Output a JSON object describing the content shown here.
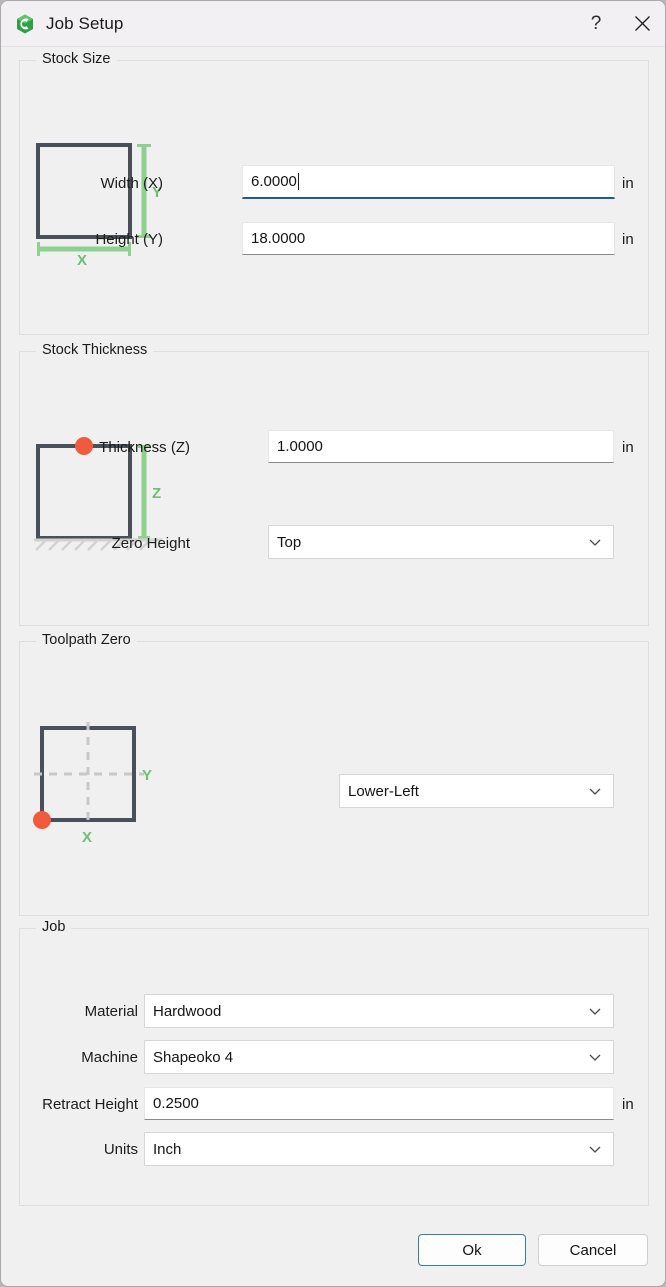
{
  "window": {
    "title": "Job Setup",
    "logo_icon": "carbide-create-logo",
    "help_label": "?",
    "close_icon": "close-icon",
    "accent_focus_color": "#1d5f8a",
    "diagram_green": "#7ec87e",
    "diagram_dark": "#4a5059",
    "diagram_orange": "#ef5b3c"
  },
  "stock_size": {
    "legend": "Stock Size",
    "width_label": "Width (X)",
    "width_value": "6.0000",
    "width_unit": "in",
    "height_label": "Height (Y)",
    "height_value": "18.0000",
    "height_unit": "in",
    "diagram": {
      "x_axis_label": "X",
      "y_axis_label": "Y"
    }
  },
  "stock_thickness": {
    "legend": "Stock Thickness",
    "thickness_label": "Thickness (Z)",
    "thickness_value": "1.0000",
    "thickness_unit": "in",
    "zero_height_label": "Zero Height",
    "zero_height_value": "Top",
    "diagram": {
      "z_axis_label": "Z"
    }
  },
  "toolpath_zero": {
    "legend": "Toolpath Zero",
    "position_value": "Lower-Left",
    "diagram": {
      "x_axis_label": "X",
      "y_axis_label": "Y"
    }
  },
  "job": {
    "legend": "Job",
    "material_label": "Material",
    "material_value": "Hardwood",
    "machine_label": "Machine",
    "machine_value": "Shapeoko 4",
    "retract_label": "Retract Height",
    "retract_value": "0.2500",
    "retract_unit": "in",
    "units_label": "Units",
    "units_value": "Inch"
  },
  "footer": {
    "ok_label": "Ok",
    "cancel_label": "Cancel"
  }
}
